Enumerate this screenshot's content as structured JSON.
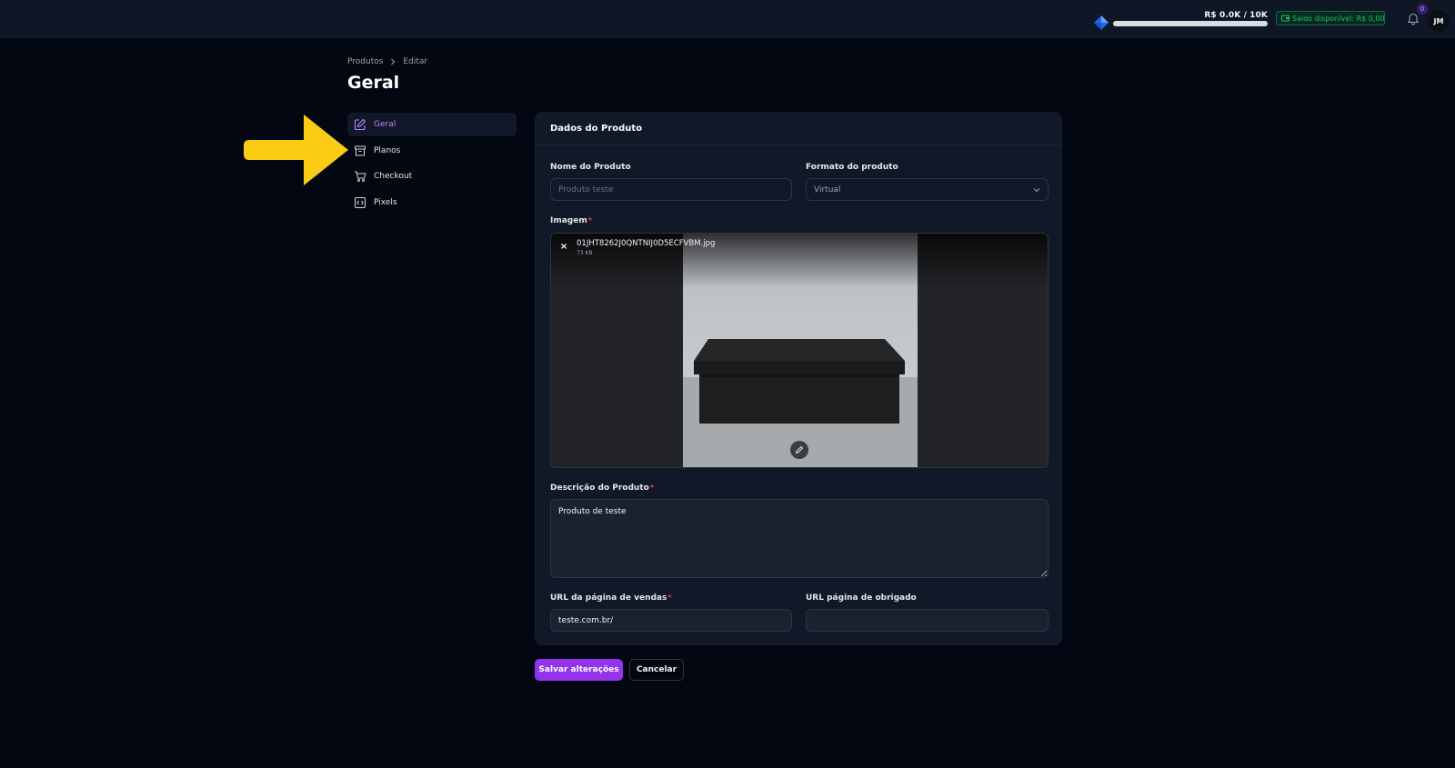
{
  "topbar": {
    "progress_text": "R$ 0.0K / 10K",
    "progress_fraction": 0.0,
    "balance_label": "Saldo disponível: R$ 0,00",
    "notifications_count": "0",
    "avatar_initials": "JM",
    "icons": [
      "diamond-logo-icon",
      "wallet-icon",
      "bell-icon"
    ]
  },
  "breadcrumb": {
    "items": [
      "Produtos",
      "Editar"
    ]
  },
  "page": {
    "title": "Geral"
  },
  "sidenav": {
    "items": [
      {
        "label": "Geral",
        "icon": "edit-icon",
        "active": true
      },
      {
        "label": "Planos",
        "icon": "box-icon",
        "active": false
      },
      {
        "label": "Checkout",
        "icon": "cart-icon",
        "active": false
      },
      {
        "label": "Pixels",
        "icon": "code-icon",
        "active": false
      }
    ]
  },
  "card": {
    "title": "Dados do Produto",
    "product_name": {
      "label": "Nome do Produto",
      "value": "",
      "placeholder": "Produto teste"
    },
    "product_format": {
      "label": "Formato do produto",
      "selected": "Virtual"
    },
    "image": {
      "label": "Imagem",
      "required_mark": "*",
      "filename": "01JHT8262J0QNTNIJ0D5ECFVBM.jpg",
      "filesize": "73 KB",
      "remove_glyph": "×"
    },
    "description": {
      "label": "Descrição do Produto",
      "required_mark": "*",
      "value": "Produto de teste"
    },
    "sales_url": {
      "label": "URL da página de vendas",
      "required_mark": "*",
      "value": "teste.com.br/"
    },
    "thanks_url": {
      "label": "URL página de obrigado",
      "value": ""
    }
  },
  "actions": {
    "save": "Salvar alterações",
    "cancel": "Cancelar"
  },
  "colors": {
    "background": "#030712",
    "card": "#111827",
    "accent": "#9333ea",
    "active_nav_text": "#c084fc",
    "balance_green": "#22c55e",
    "arrow_yellow": "#facc15"
  }
}
